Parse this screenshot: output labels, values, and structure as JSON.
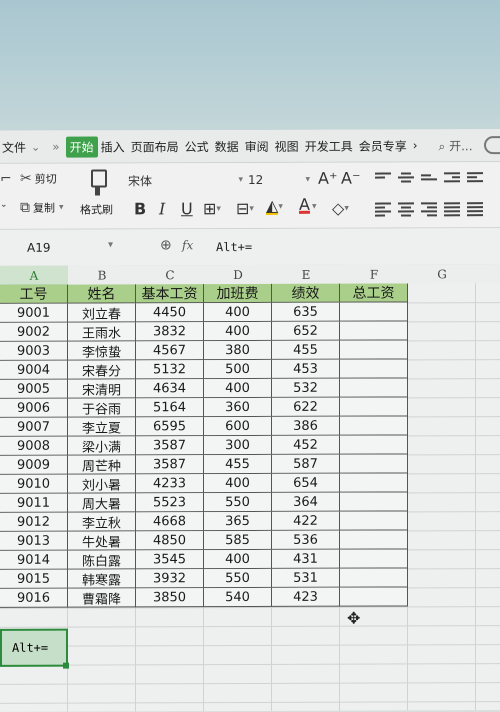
{
  "menu": {
    "file": "文件",
    "tabs": [
      "开始",
      "插入",
      "页面布局",
      "公式",
      "数据",
      "审阅",
      "视图",
      "开发工具",
      "会员专享"
    ],
    "active": "开始",
    "search_label": "开..."
  },
  "toolbar": {
    "cut": "剪切",
    "copy": "复制",
    "format_painter": "格式刷",
    "font_name": "宋体",
    "font_size": "12",
    "bold": "B",
    "italic": "I",
    "underline": "U",
    "font_color_label": "A",
    "increase_font": "A⁺",
    "decrease_font": "A⁻"
  },
  "formula": {
    "name_box": "A19",
    "fx": "fx",
    "value": "Alt+="
  },
  "columns": [
    "A",
    "B",
    "C",
    "D",
    "E",
    "F",
    "G"
  ],
  "table": {
    "headers": [
      "工号",
      "姓名",
      "基本工资",
      "加班费",
      "绩效",
      "总工资"
    ],
    "rows": [
      [
        "9001",
        "刘立春",
        "4450",
        "400",
        "635",
        ""
      ],
      [
        "9002",
        "王雨水",
        "3832",
        "400",
        "652",
        ""
      ],
      [
        "9003",
        "李惊蛰",
        "4567",
        "380",
        "455",
        ""
      ],
      [
        "9004",
        "宋春分",
        "5132",
        "500",
        "453",
        ""
      ],
      [
        "9005",
        "宋清明",
        "4634",
        "400",
        "532",
        ""
      ],
      [
        "9006",
        "于谷雨",
        "5164",
        "360",
        "622",
        ""
      ],
      [
        "9007",
        "李立夏",
        "6595",
        "600",
        "386",
        ""
      ],
      [
        "9008",
        "梁小满",
        "3587",
        "300",
        "452",
        ""
      ],
      [
        "9009",
        "周芒种",
        "3587",
        "455",
        "587",
        ""
      ],
      [
        "9010",
        "刘小暑",
        "4233",
        "400",
        "654",
        ""
      ],
      [
        "9011",
        "周大暑",
        "5523",
        "550",
        "364",
        ""
      ],
      [
        "9012",
        "李立秋",
        "4668",
        "365",
        "422",
        ""
      ],
      [
        "9013",
        "牛处暑",
        "4850",
        "585",
        "536",
        ""
      ],
      [
        "9014",
        "陈白露",
        "3545",
        "400",
        "431",
        ""
      ],
      [
        "9015",
        "韩寒露",
        "3932",
        "550",
        "531",
        ""
      ],
      [
        "9016",
        "曹霜降",
        "3850",
        "540",
        "423",
        ""
      ]
    ]
  },
  "selected_cell_text": "Alt+=",
  "colors": {
    "accent": "#3fa14b",
    "header_fill": "#a9cf8a",
    "selection": "#2e8b3e"
  }
}
